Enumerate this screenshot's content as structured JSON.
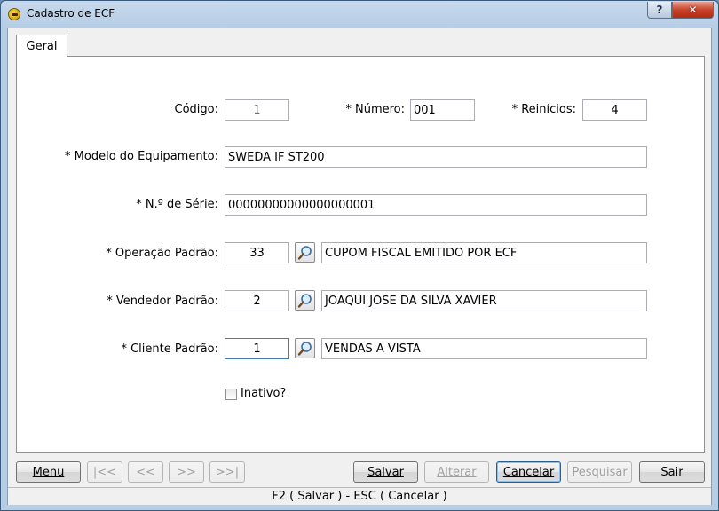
{
  "window": {
    "title": "Cadastro de ECF",
    "help_label": "?",
    "close_label": "✕"
  },
  "tabs": [
    {
      "label": "Geral",
      "active": true
    }
  ],
  "form": {
    "codigo": {
      "label": "Código:",
      "value": "1"
    },
    "numero": {
      "label": "* Número:",
      "value": "001"
    },
    "reinicios": {
      "label": "* Reinícios:",
      "value": "4"
    },
    "modelo": {
      "label": "* Modelo do Equipamento:",
      "value": "SWEDA IF ST200"
    },
    "serie": {
      "label": "* N.º de Série:",
      "value": "00000000000000000001"
    },
    "operacao": {
      "label": "* Operação Padrão:",
      "code": "33",
      "description": "CUPOM FISCAL EMITIDO POR ECF"
    },
    "vendedor": {
      "label": "* Vendedor Padrão:",
      "code": "2",
      "description": "JOAQUI JOSE DA SILVA XAVIER"
    },
    "cliente": {
      "label": "* Cliente Padrão:",
      "code": "1",
      "description": "VENDAS A VISTA"
    },
    "inativo": {
      "label": "Inativo?",
      "checked": false
    }
  },
  "toolbar": {
    "menu_label": "Menu",
    "first_label": "|<<",
    "prev_label": "<<",
    "next_label": ">>",
    "last_label": ">>|",
    "salvar_label": "Salvar",
    "alterar_label": "Alterar",
    "cancelar_label": "Cancelar",
    "pesquisar_label": "Pesquisar",
    "sair_label": "Sair"
  },
  "status": {
    "text": "F2 ( Salvar )  -  ESC ( Cancelar )"
  },
  "icons": {
    "app": "ecf-app-icon",
    "lookup": "magnifier-icon"
  }
}
